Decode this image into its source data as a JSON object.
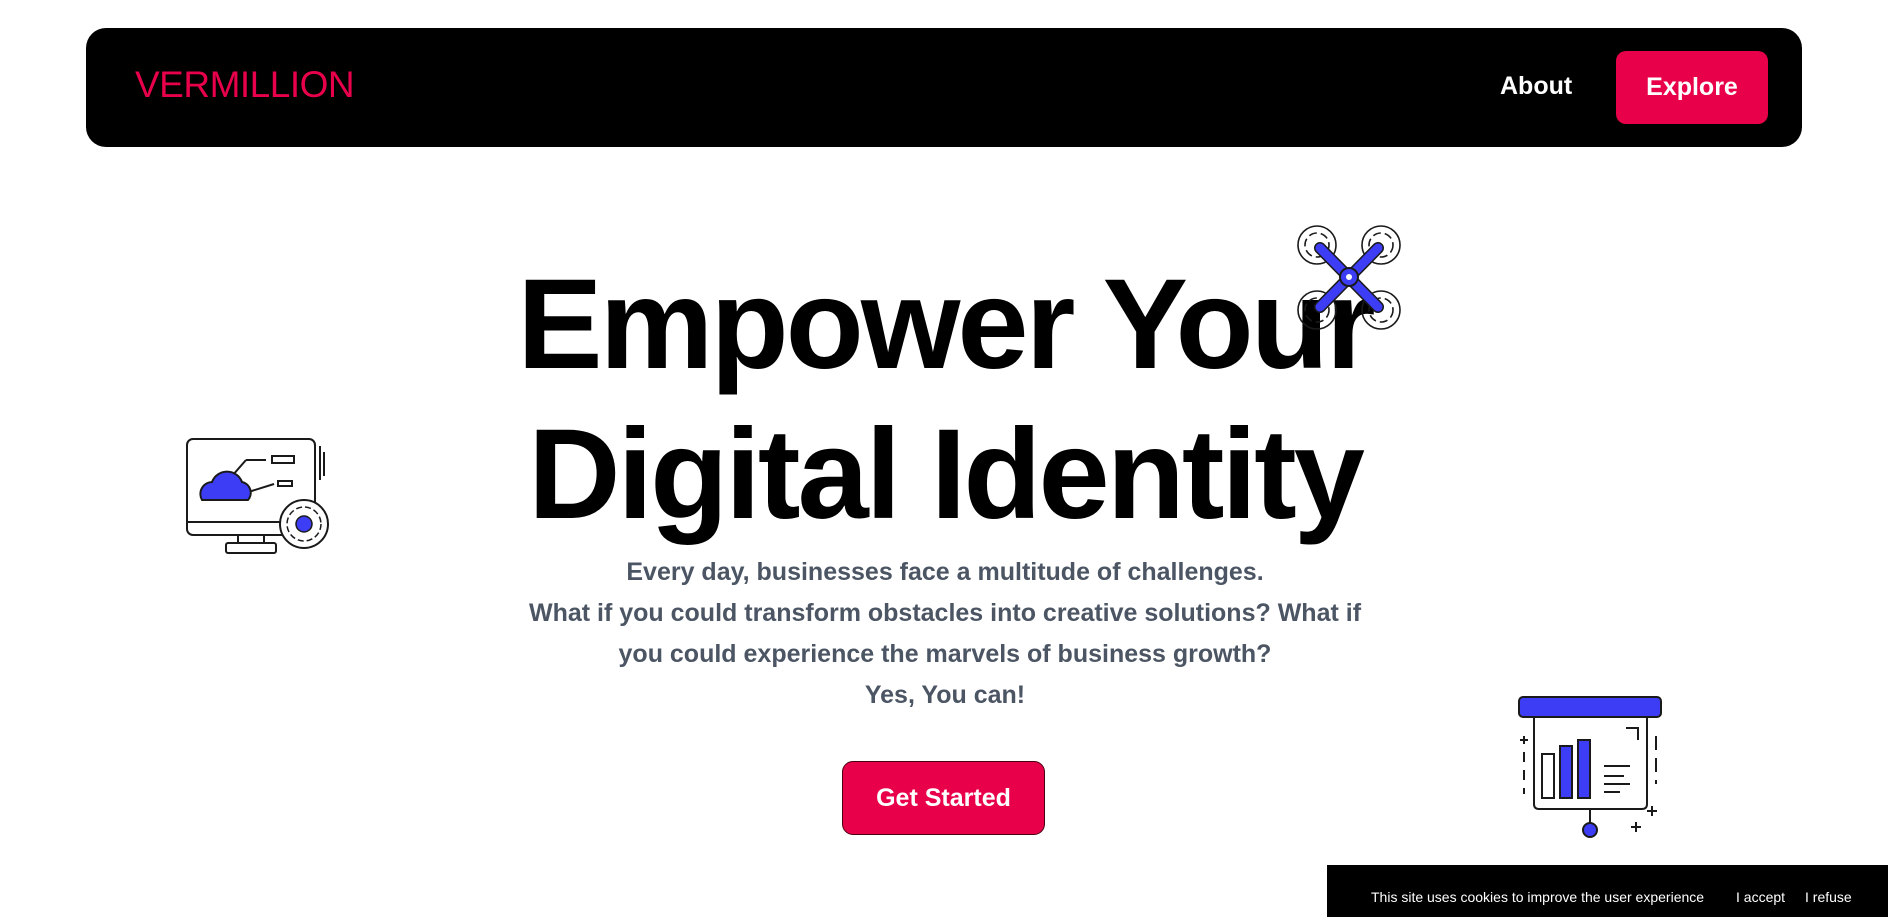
{
  "nav": {
    "logo": "VERMILLION",
    "about_label": "About",
    "explore_label": "Explore"
  },
  "hero": {
    "title_lines": [
      "Empower Your",
      "Digital Identity"
    ],
    "subtitle_lines": [
      "Every day, businesses face a multitude of challenges.",
      "What if you could transform obstacles into creative solutions? What if",
      "you could experience the marvels of business growth?",
      "Yes, You can!"
    ],
    "cta_label": "Get Started"
  },
  "illustrations": {
    "drone": "drone-icon",
    "monitor": "cloud-monitor-icon",
    "chart": "presentation-chart-icon"
  },
  "cookie": {
    "text": "This site uses cookies to improve the user experience",
    "accept_label": "I accept",
    "refuse_label": "I refuse"
  },
  "colors": {
    "brand": "#e8004a",
    "accent": "#3d3df5",
    "text_muted": "#4b5563",
    "nav_bg": "#000000"
  }
}
